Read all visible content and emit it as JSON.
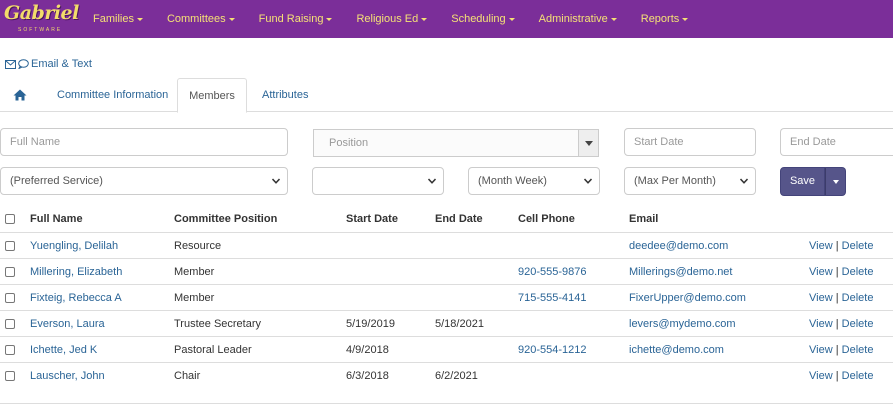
{
  "brand": {
    "name": "Gabriel",
    "tagline": "SOFTWARE",
    "accent": "#7b2e99",
    "menu_color": "#f5e176"
  },
  "nav": {
    "items": [
      {
        "label": "Families"
      },
      {
        "label": "Committees"
      },
      {
        "label": "Fund Raising"
      },
      {
        "label": "Religious Ed"
      },
      {
        "label": "Scheduling"
      },
      {
        "label": "Administrative"
      },
      {
        "label": "Reports"
      }
    ]
  },
  "email_text": {
    "label": "Email & Text",
    "icons": [
      "envelope-icon",
      "chat-icon"
    ]
  },
  "tabs": [
    {
      "label": "Committee Information"
    },
    {
      "label": "Members"
    },
    {
      "label": "Attributes"
    }
  ],
  "filters": {
    "full_name_placeholder": "Full Name",
    "position_placeholder": "Position",
    "start_date_placeholder": "Start Date",
    "end_date_placeholder": "End Date",
    "preferred_service": "(Preferred Service)",
    "blank_select": "",
    "month_week": "(Month Week)",
    "max_per_month": "(Max Per Month)"
  },
  "save": {
    "label": "Save"
  },
  "table": {
    "columns": [
      "Full Name",
      "Committee Position",
      "Start Date",
      "End Date",
      "Cell Phone",
      "Email"
    ],
    "rows": [
      {
        "name": "Yuengling, Delilah",
        "position": "Resource",
        "start": "",
        "end": "",
        "phone": "",
        "email": "deedee@demo.com"
      },
      {
        "name": "Millering, Elizabeth",
        "position": "Member",
        "start": "",
        "end": "",
        "phone": "920-555-9876",
        "email": "Millerings@demo.net"
      },
      {
        "name": "Fixteig, Rebecca A",
        "position": "Member",
        "start": "",
        "end": "",
        "phone": "715-555-4141",
        "email": "FixerUpper@demo.com"
      },
      {
        "name": "Everson, Laura",
        "position": "Trustee Secretary",
        "start": "5/19/2019",
        "end": "5/18/2021",
        "phone": "",
        "email": "levers@mydemo.com"
      },
      {
        "name": "Ichette, Jed K",
        "position": "Pastoral Leader",
        "start": "4/9/2018",
        "end": "",
        "phone": "920-554-1212",
        "email": "ichette@demo.com"
      },
      {
        "name": "Lauscher, John",
        "position": "Chair",
        "start": "6/3/2018",
        "end": "6/2/2021",
        "phone": "",
        "email": ""
      }
    ],
    "view_label": "View",
    "delete_label": "Delete",
    "action_separator": "|"
  }
}
